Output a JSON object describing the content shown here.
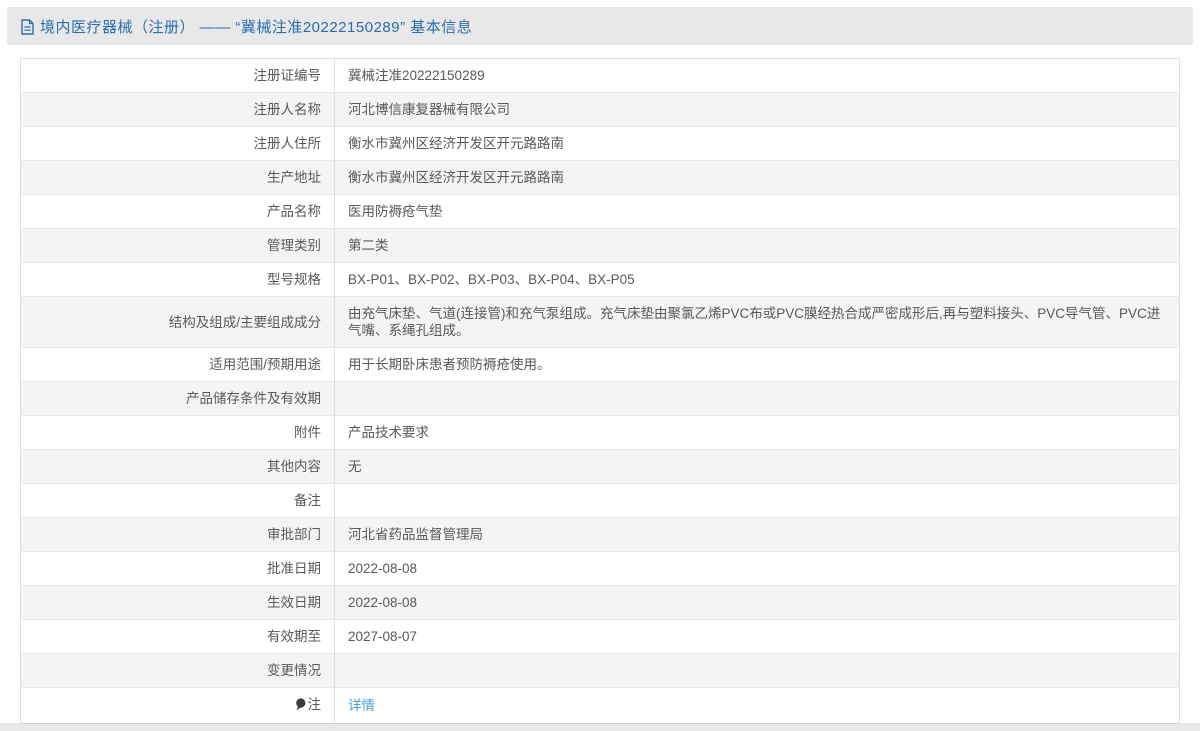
{
  "header": {
    "title": "境内医疗器械（注册） —— “冀械注准20222150289” 基本信息",
    "icon": "document-icon"
  },
  "colors": {
    "accent_blue": "#2a6daf",
    "link_blue": "#4b9cd6",
    "titlebar_bg": "#e8e8e8",
    "alt_row_bg": "#f4f4f4",
    "text": "#595959"
  },
  "table": {
    "rows": [
      {
        "label": "注册证编号",
        "value": "冀械注准20222150289"
      },
      {
        "label": "注册人名称",
        "value": "河北博信康复器械有限公司"
      },
      {
        "label": "注册人住所",
        "value": "衡水市冀州区经济开发区开元路路南"
      },
      {
        "label": "生产地址",
        "value": "衡水市冀州区经济开发区开元路路南"
      },
      {
        "label": "产品名称",
        "value": "医用防褥疮气垫"
      },
      {
        "label": "管理类别",
        "value": "第二类"
      },
      {
        "label": "型号规格",
        "value": "BX-P01、BX-P02、BX-P03、BX-P04、BX-P05"
      },
      {
        "label": "结构及组成/主要组成成分",
        "value": "由充气床垫、气道(连接管)和充气泵组成。充气床垫由聚氯乙烯PVC布或PVC膜经热合成严密成形后,再与塑料接头、PVC导气管、PVC进气嘴、系绳孔组成。"
      },
      {
        "label": "适用范围/预期用途",
        "value": "用于长期卧床患者预防褥疮使用。"
      },
      {
        "label": "产品储存条件及有效期",
        "value": ""
      },
      {
        "label": "附件",
        "value": "产品技术要求"
      },
      {
        "label": "其他内容",
        "value": "无"
      },
      {
        "label": "备注",
        "value": ""
      },
      {
        "label": "审批部门",
        "value": "河北省药品监督管理局"
      },
      {
        "label": "批准日期",
        "value": "2022-08-08"
      },
      {
        "label": "生效日期",
        "value": "2022-08-08"
      },
      {
        "label": "有效期至",
        "value": "2027-08-07"
      },
      {
        "label": "变更情况",
        "value": ""
      },
      {
        "label": "注",
        "icon": "bulb-icon",
        "value": "详情",
        "link": true
      }
    ]
  }
}
